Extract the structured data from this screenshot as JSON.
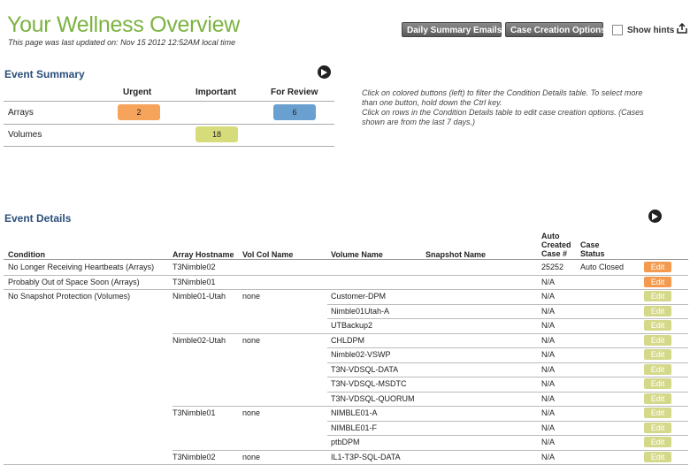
{
  "header": {
    "title": "Your Wellness Overview",
    "updated": "This page was last updated on: Nov 15 2012 12:52AM local time",
    "daily_summary_button": "Daily Summary Emails...",
    "case_options_button": "Case Creation Options...",
    "show_hints_label": "Show hints",
    "show_hints_checked": false
  },
  "summary": {
    "title": "Event Summary",
    "columns": [
      "Urgent",
      "Important",
      "For Review"
    ],
    "rows": [
      {
        "label": "Arrays",
        "urgent": "2",
        "important": "",
        "review": "6"
      },
      {
        "label": "Volumes",
        "urgent": "",
        "important": "18",
        "review": ""
      }
    ],
    "help": [
      "Click on colored buttons (left) to filter the Condition Details table.  To select more than one button, hold down the Ctrl key.",
      "Click on rows in the Condition Details table to edit case creation options.  (Cases shown are from the last 7 days.)"
    ]
  },
  "details": {
    "title": "Event Details",
    "headers": {
      "condition": "Condition",
      "array": "Array Hostname",
      "volcol": "Vol Col Name",
      "volume": "Volume Name",
      "snapshot": "Snapshot Name",
      "case": "Auto Created Case #",
      "status": "Case Status"
    },
    "edit_label": "Edit",
    "rows": [
      {
        "condition": "No Longer Receiving Heartbeats (Arrays)",
        "array": "T3Nimble02",
        "volcol": "",
        "volume": "",
        "snapshot": "",
        "case": "25252",
        "status": "Auto Closed",
        "level": "urgent"
      },
      {
        "condition": "Probably Out of Space Soon (Arrays)",
        "array": "T3Nimble01",
        "volcol": "",
        "volume": "",
        "snapshot": "",
        "case": "N/A",
        "status": "",
        "level": "urgent"
      },
      {
        "condition": "No Snapshot Protection (Volumes)",
        "array": "Nimble01-Utah",
        "volcol": "none",
        "volume": "Customer-DPM",
        "snapshot": "",
        "case": "N/A",
        "status": "",
        "level": "important"
      },
      {
        "condition": "",
        "array": "",
        "volcol": "",
        "volume": "Nimble01Utah-A",
        "snapshot": "",
        "case": "N/A",
        "status": "",
        "level": "important"
      },
      {
        "condition": "",
        "array": "",
        "volcol": "",
        "volume": "UTBackup2",
        "snapshot": "",
        "case": "N/A",
        "status": "",
        "level": "important"
      },
      {
        "condition": "",
        "array": "Nimble02-Utah",
        "volcol": "none",
        "volume": "CHLDPM",
        "snapshot": "",
        "case": "N/A",
        "status": "",
        "level": "important"
      },
      {
        "condition": "",
        "array": "",
        "volcol": "",
        "volume": "Nimble02-VSWP",
        "snapshot": "",
        "case": "N/A",
        "status": "",
        "level": "important"
      },
      {
        "condition": "",
        "array": "",
        "volcol": "",
        "volume": "T3N-VDSQL-DATA",
        "snapshot": "",
        "case": "N/A",
        "status": "",
        "level": "important"
      },
      {
        "condition": "",
        "array": "",
        "volcol": "",
        "volume": "T3N-VDSQL-MSDTC",
        "snapshot": "",
        "case": "N/A",
        "status": "",
        "level": "important"
      },
      {
        "condition": "",
        "array": "",
        "volcol": "",
        "volume": "T3N-VDSQL-QUORUM",
        "snapshot": "",
        "case": "N/A",
        "status": "",
        "level": "important"
      },
      {
        "condition": "",
        "array": "T3Nimble01",
        "volcol": "none",
        "volume": "NIMBLE01-A",
        "snapshot": "",
        "case": "N/A",
        "status": "",
        "level": "important"
      },
      {
        "condition": "",
        "array": "",
        "volcol": "",
        "volume": "NIMBLE01-F",
        "snapshot": "",
        "case": "N/A",
        "status": "",
        "level": "important"
      },
      {
        "condition": "",
        "array": "",
        "volcol": "",
        "volume": "ptbDPM",
        "snapshot": "",
        "case": "N/A",
        "status": "",
        "level": "important"
      },
      {
        "condition": "",
        "array": "T3Nimble02",
        "volcol": "none",
        "volume": "IL1-T3P-SQL-DATA",
        "snapshot": "",
        "case": "N/A",
        "status": "",
        "level": "important"
      }
    ]
  },
  "colors": {
    "title_green": "#7cb342",
    "section_blue": "#2a4f7a",
    "urgent": "#f6a35c",
    "important": "#d7dc7a",
    "review": "#6aa0cf",
    "edit_urgent": "#f39a4f",
    "edit_important": "#d4d98a"
  }
}
